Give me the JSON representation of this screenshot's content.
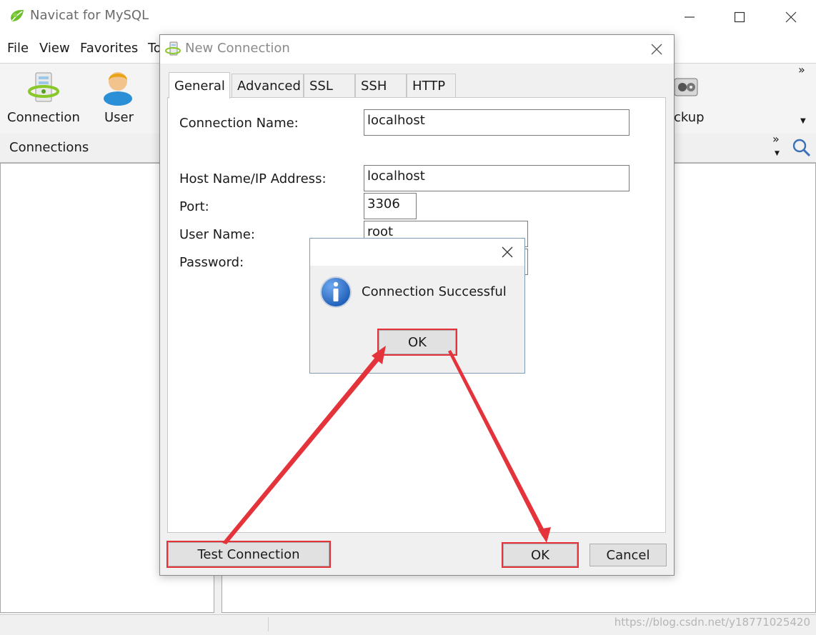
{
  "app": {
    "title": "Navicat for MySQL",
    "window_controls": [
      "minimize-icon",
      "maximize-icon",
      "close-icon"
    ]
  },
  "menu": {
    "items": [
      "File",
      "View",
      "Favorites",
      "To"
    ]
  },
  "toolbar": {
    "items": [
      {
        "label": "Connection",
        "icon": "connection-icon"
      },
      {
        "label": "User",
        "icon": "user-icon"
      },
      {
        "label": "ckup",
        "icon": "backup-icon"
      }
    ],
    "overflow_icon": "chevron-double-right-icon"
  },
  "connections_panel": {
    "header": "Connections"
  },
  "dialog": {
    "title": "New Connection",
    "tabs": [
      "General",
      "Advanced",
      "SSL",
      "SSH",
      "HTTP"
    ],
    "active_tab": "General",
    "fields": {
      "connection_name": {
        "label": "Connection Name:",
        "value": "localhost"
      },
      "host": {
        "label": "Host Name/IP Address:",
        "value": "localhost"
      },
      "port": {
        "label": "Port:",
        "value": "3306"
      },
      "user": {
        "label": "User Name:",
        "value": "root"
      },
      "password": {
        "label": "Password:",
        "value": ""
      }
    },
    "buttons": {
      "test": "Test Connection",
      "ok": "OK",
      "cancel": "Cancel"
    }
  },
  "message_box": {
    "text": "Connection Successful",
    "icon": "info-icon",
    "ok": "OK"
  },
  "watermark": "https://blog.csdn.net/y18771025420",
  "colors": {
    "highlight": "#e5333b",
    "info_blue": "#1f5fb8",
    "app_green": "#6cbf2a"
  }
}
